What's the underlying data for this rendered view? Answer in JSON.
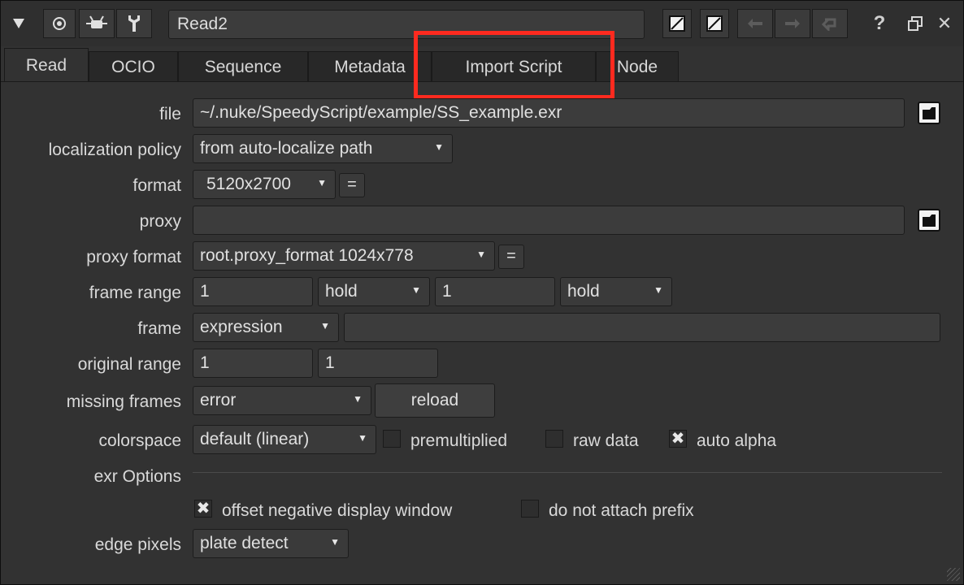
{
  "toolbar": {
    "node_name": "Read2",
    "icons": [
      "collapse-arrow-icon",
      "circle-target-icon",
      "bug-icon",
      "wrench-icon",
      "mask-icon-1",
      "mask-icon-2",
      "undo-icon",
      "redo-icon",
      "revert-icon",
      "help-icon",
      "float-icon",
      "close-icon"
    ],
    "help_glyph": "?",
    "close_glyph": "✕"
  },
  "tabs": [
    {
      "label": "Read",
      "active": true
    },
    {
      "label": "OCIO"
    },
    {
      "label": "Sequence"
    },
    {
      "label": "Metadata"
    },
    {
      "label": "Import Script"
    },
    {
      "label": "Node"
    }
  ],
  "fields": {
    "file": {
      "label": "file",
      "value": "~/.nuke/SpeedyScript/example/SS_example.exr"
    },
    "localization_policy": {
      "label": "localization policy",
      "value": "from auto-localize path"
    },
    "format": {
      "label": "format",
      "value": "5120x2700",
      "eq": "="
    },
    "proxy": {
      "label": "proxy",
      "value": ""
    },
    "proxy_format": {
      "label": "proxy format",
      "value": "root.proxy_format 1024x778",
      "eq": "="
    },
    "frame_range": {
      "label": "frame range",
      "first": "1",
      "before": "hold",
      "last": "1",
      "after": "hold"
    },
    "frame": {
      "label": "frame",
      "mode": "expression",
      "value": ""
    },
    "original_range": {
      "label": "original range",
      "first": "1",
      "last": "1"
    },
    "missing_frames": {
      "label": "missing frames",
      "value": "error",
      "reload": "reload"
    },
    "colorspace": {
      "label": "colorspace",
      "value": "default (linear)",
      "premultiplied": "premultiplied",
      "raw_data": "raw data",
      "auto_alpha": "auto alpha"
    },
    "exr_options": {
      "label": "exr Options",
      "offset_neg": "offset negative display window",
      "no_prefix": "do not attach prefix"
    },
    "edge_pixels": {
      "label": "edge pixels",
      "value": "plate detect"
    }
  },
  "checked_glyph": "✖",
  "colors": {
    "highlight": "#ff2a1f",
    "panel": "#323232"
  }
}
